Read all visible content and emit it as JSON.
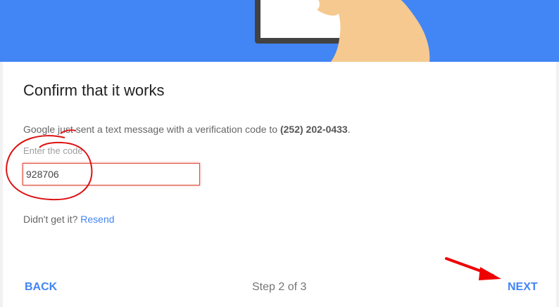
{
  "header": {
    "illustration": "hand-holding-phone-illustration",
    "background_color": "#4285f4"
  },
  "main": {
    "title": "Confirm that it works",
    "message_prefix": "Google just sent a text message with a verification code to ",
    "phone_number": "(252) 202-0433",
    "message_suffix": ".",
    "code_label": "Enter the code",
    "code_value": "928706",
    "resend_prompt": "Didn't get it? ",
    "resend_label": "Resend"
  },
  "footer": {
    "back_label": "BACK",
    "step_label": "Step 2 of 3",
    "next_label": "NEXT"
  },
  "annotations": {
    "circle_color": "#dd1111",
    "arrow_color": "#ee0000"
  }
}
